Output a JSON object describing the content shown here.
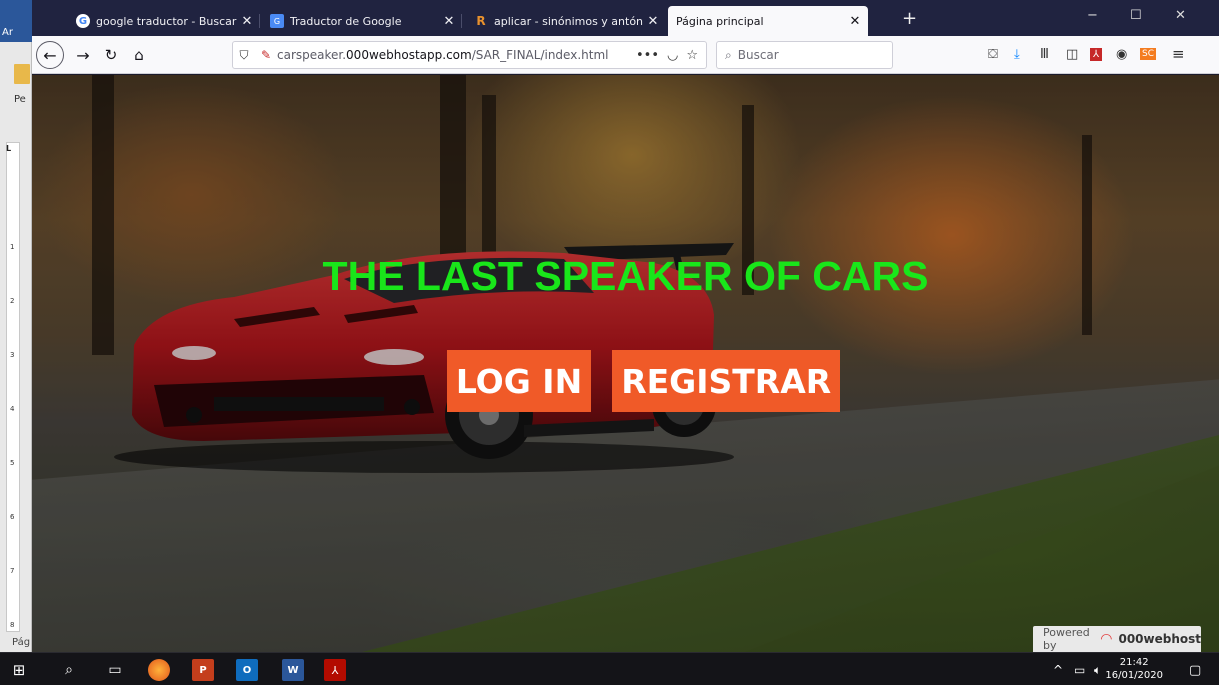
{
  "word": {
    "menu_fragment": "Ar",
    "panel_fragment": "Pe",
    "status_fragment": "Pág",
    "ruler_corner": "L",
    "ruler_numbers": [
      "1",
      "2",
      "3",
      "4",
      "5",
      "6",
      "7",
      "8"
    ]
  },
  "browser": {
    "tabs": [
      {
        "label": "google traductor - Buscar con",
        "icon": "google-icon",
        "color": "#4285f4"
      },
      {
        "label": "Traductor de Google",
        "icon": "google-translate-icon",
        "color": "#4a8af4"
      },
      {
        "label": "aplicar - sinónimos y antónimo",
        "icon": "wordreference-icon",
        "color": "#e8912d"
      },
      {
        "label": "Página principal",
        "icon": "",
        "color": ""
      }
    ],
    "new_tab": "+",
    "window_controls": [
      "−",
      "☐",
      "✕"
    ],
    "url": {
      "prefix": "carspeaker.",
      "domain": "000webhostapp.com",
      "path": "/SAR_FINAL/index.html"
    },
    "search_placeholder": "Buscar"
  },
  "page": {
    "title": "THE LAST SPEAKER OF CARS",
    "buttons": {
      "login": "LOG IN",
      "register": "REGISTRAR"
    },
    "powered_by": {
      "prefix": "Powered by",
      "brand": "000webhost"
    },
    "colors": {
      "title": "#19e61a",
      "button_bg": "#f05a28",
      "button_text": "#ffffff"
    }
  },
  "taskbar": {
    "time": "21:42",
    "date": "16/01/2020"
  }
}
